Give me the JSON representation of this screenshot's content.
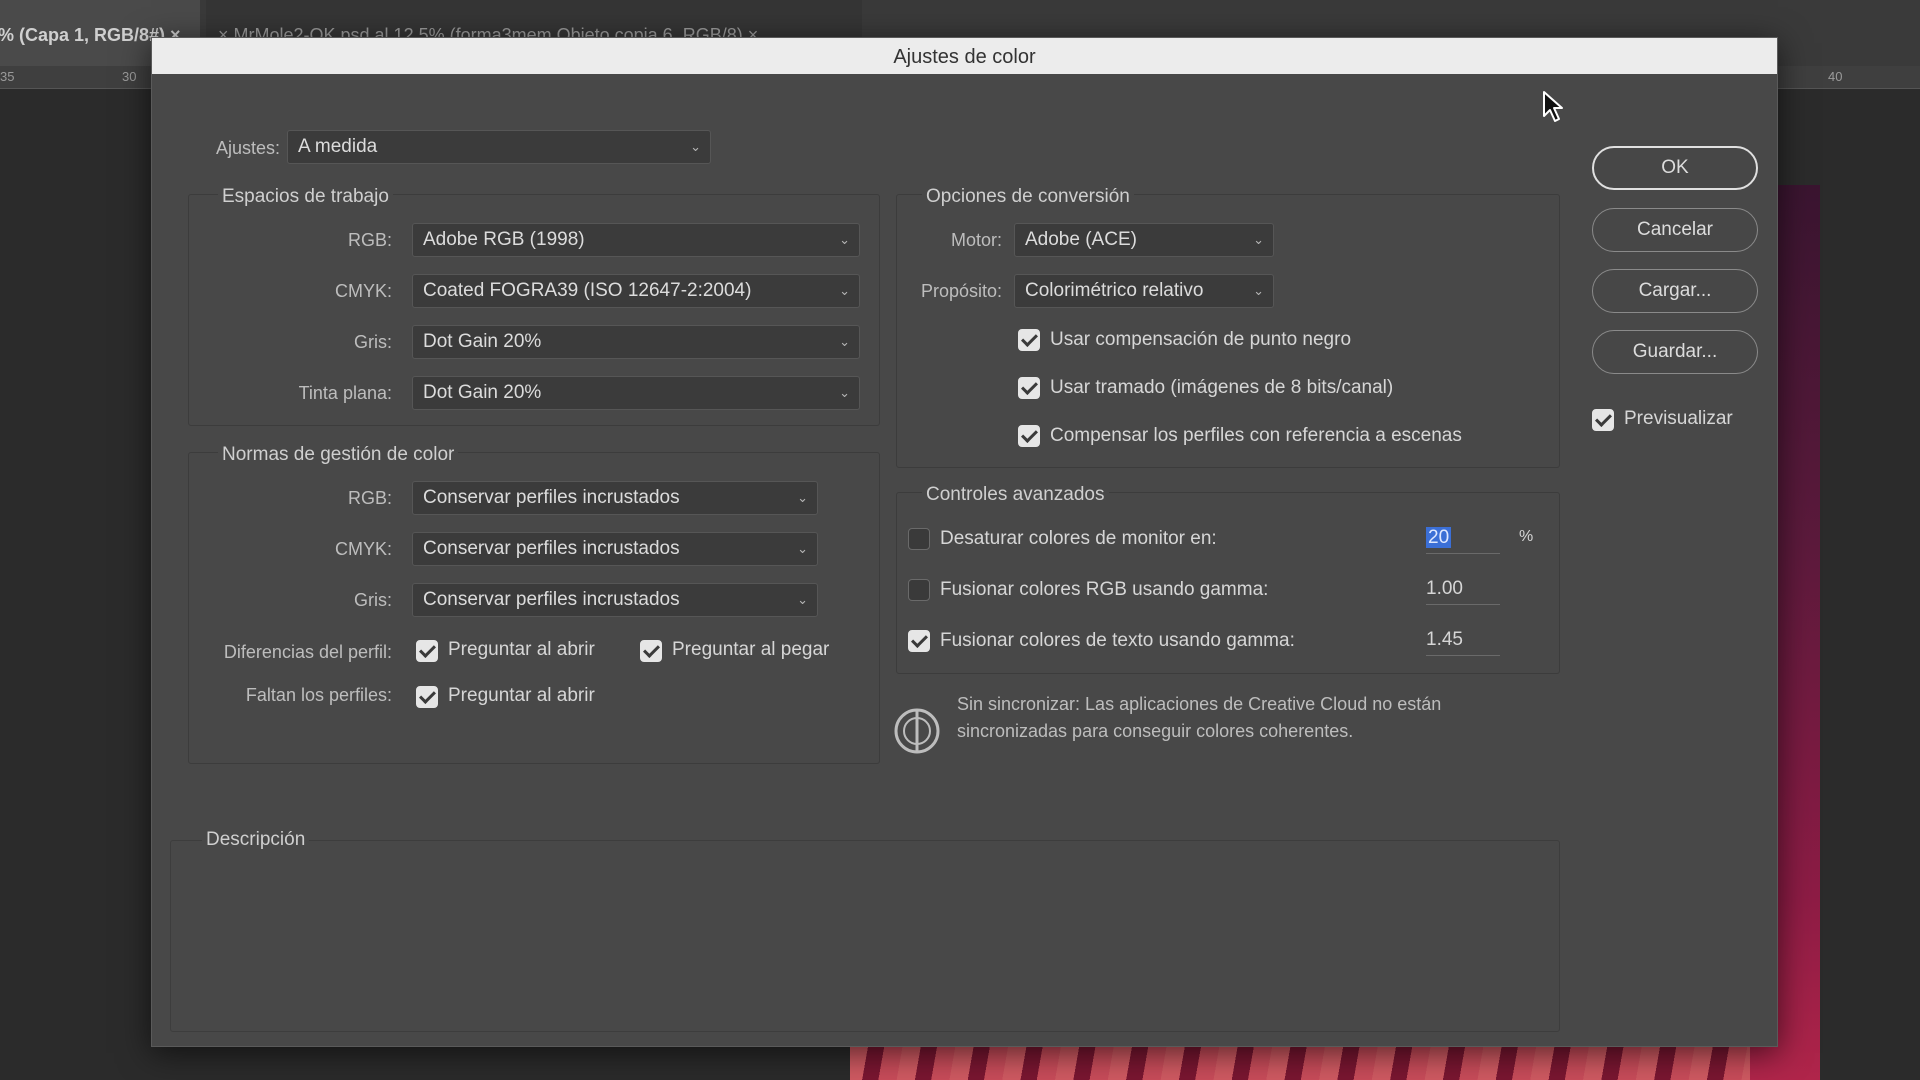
{
  "background": {
    "doc_tab_active": "% (Capa 1, RGB/8#) ×",
    "doc_tab_other": "× MrMole2-OK.psd al 12,5% (forma3mem,Objeto copia 6, RGB/8) ×",
    "ruler_labels": [
      "35",
      "30",
      "40"
    ]
  },
  "dialog": {
    "title": "Ajustes de color",
    "settings_label": "Ajustes:",
    "settings_value": "A medida",
    "working_spaces": {
      "title": "Espacios de trabajo",
      "rgb_label": "RGB:",
      "rgb_value": "Adobe RGB (1998)",
      "cmyk_label": "CMYK:",
      "cmyk_value": "Coated FOGRA39 (ISO 12647-2:2004)",
      "gray_label": "Gris:",
      "gray_value": "Dot Gain 20%",
      "spot_label": "Tinta plana:",
      "spot_value": "Dot Gain 20%"
    },
    "color_policies": {
      "title": "Normas de gestión de color",
      "rgb_label": "RGB:",
      "rgb_value": "Conservar perfiles incrustados",
      "cmyk_label": "CMYK:",
      "cmyk_value": "Conservar perfiles incrustados",
      "gray_label": "Gris:",
      "gray_value": "Conservar perfiles incrustados",
      "mismatch_label": "Diferencias del perfil:",
      "mismatch_open": "Preguntar al abrir",
      "mismatch_open_checked": true,
      "mismatch_paste": "Preguntar al pegar",
      "mismatch_paste_checked": true,
      "missing_label": "Faltan los perfiles:",
      "missing_open": "Preguntar al abrir",
      "missing_open_checked": true
    },
    "conversion": {
      "title": "Opciones de conversión",
      "engine_label": "Motor:",
      "engine_value": "Adobe (ACE)",
      "intent_label": "Propósito:",
      "intent_value": "Colorimétrico relativo",
      "black_point": "Usar compensación de punto negro",
      "black_point_checked": true,
      "dither": "Usar tramado (imágenes de 8 bits/canal)",
      "dither_checked": true,
      "scene_ref": "Compensar los perfiles con referencia a escenas",
      "scene_ref_checked": true
    },
    "advanced": {
      "title": "Controles avanzados",
      "desaturate": "Desaturar colores de monitor en:",
      "desaturate_checked": false,
      "desaturate_value": "20",
      "desaturate_unit": "%",
      "blend_rgb": "Fusionar colores RGB usando gamma:",
      "blend_rgb_checked": false,
      "blend_rgb_value": "1.00",
      "blend_text": "Fusionar colores de texto usando gamma:",
      "blend_text_checked": true,
      "blend_text_value": "1.45"
    },
    "sync_message_line1": "Sin sincronizar: Las aplicaciones de Creative Cloud no están",
    "sync_message_line2": "sincronizadas para conseguir colores coherentes.",
    "description_title": "Descripción",
    "buttons": {
      "ok": "OK",
      "cancel": "Cancelar",
      "load": "Cargar...",
      "save": "Guardar..."
    },
    "preview_label": "Previsualizar",
    "preview_checked": true
  }
}
